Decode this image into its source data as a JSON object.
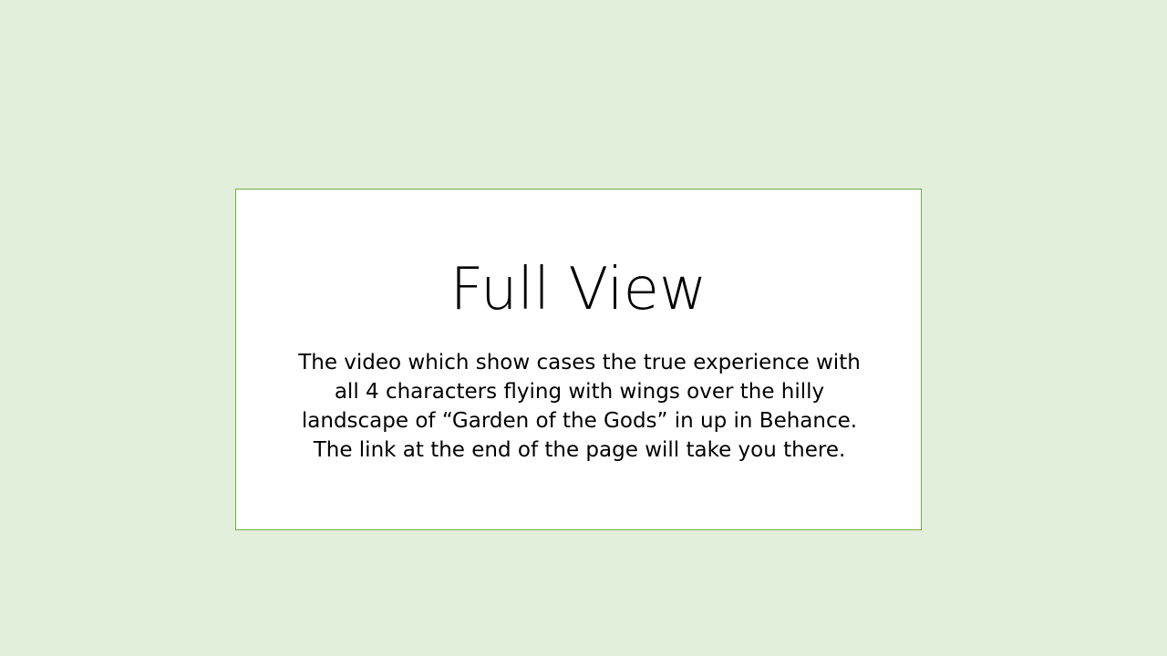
{
  "slide": {
    "title": "Full View",
    "body_lines": [
      "The video which show cases the true experience with",
      "all 4 characters flying with wings over the hilly",
      "landscape of “Garden of the Gods” in up in Behance.",
      "The link at the end of the page will take you there."
    ]
  },
  "colors": {
    "background": "#e2efda",
    "card_fill": "#ffffff",
    "card_border": "#70ad47",
    "text": "#000000"
  }
}
